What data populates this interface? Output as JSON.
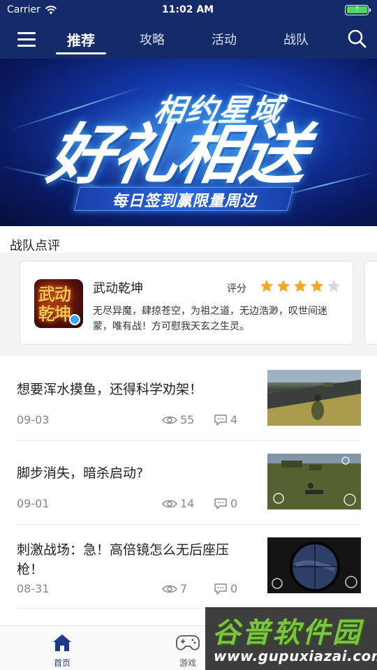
{
  "status_bar": {
    "carrier": "Carrier",
    "time": "11:02 AM"
  },
  "nav": {
    "tabs": [
      {
        "label": "推荐",
        "active": true
      },
      {
        "label": "攻略",
        "active": false
      },
      {
        "label": "活动",
        "active": false
      },
      {
        "label": "战队",
        "active": false
      }
    ]
  },
  "banner": {
    "subtitle": "相约星域",
    "title": "好礼相送",
    "caption": "每日签到赢限量周边"
  },
  "team_review": {
    "section_title": "战队点评",
    "card": {
      "game_icon_text": "武动乾坤",
      "game_name": "武动乾坤",
      "rating_label": "评分",
      "rating": 4,
      "rating_max": 5,
      "text": "无尽异魔，肆掠苍空，为祖之道，无边浩渺，叹世间迷蒙，唯有战！方可慰我天玄之生灵。"
    }
  },
  "articles": [
    {
      "title": "想要浑水摸鱼，还得科学劝架！",
      "date": "09-03",
      "views": "55",
      "comments": "4"
    },
    {
      "title": "脚步消失，暗杀启动?",
      "date": "09-01",
      "views": "14",
      "comments": "0"
    },
    {
      "title": "刺激战场：急！高倍镜怎么无后座压枪！",
      "date": "08-31",
      "views": "7",
      "comments": "0"
    }
  ],
  "tabbar": {
    "items": [
      {
        "label": "首页",
        "active": true
      },
      {
        "label": "游戏",
        "active": false
      }
    ]
  },
  "watermark": {
    "title": "谷普软件园",
    "url": "www.gupuxiazai.com"
  },
  "colors": {
    "header_bg": "#152a68",
    "star_on": "#f5a623",
    "star_off": "#d8d8d8",
    "tab_active": "#1e3a8a"
  }
}
